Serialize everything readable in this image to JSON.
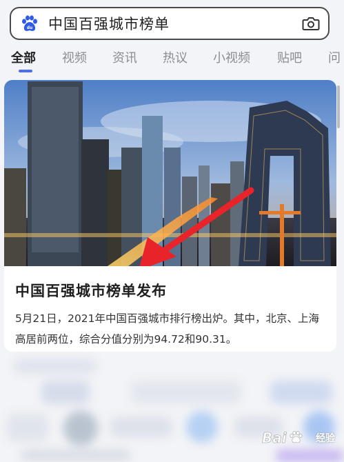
{
  "search": {
    "query": "中国百强城市榜单",
    "logo_icon": "baidu-paw-icon",
    "camera_icon": "camera-icon"
  },
  "tabs": [
    {
      "label": "全部",
      "active": true
    },
    {
      "label": "视频",
      "active": false
    },
    {
      "label": "资讯",
      "active": false
    },
    {
      "label": "热议",
      "active": false
    },
    {
      "label": "小视频",
      "active": false
    },
    {
      "label": "贴吧",
      "active": false
    },
    {
      "label": "问",
      "active": false
    }
  ],
  "result_card": {
    "title": "中国百强城市榜单发布",
    "description": "5月21日，2021年中国百强城市排行榜出炉。其中，北京、上海高居前两位，综合分值分别为94.72和90.31。"
  },
  "watermark": {
    "text": "经验"
  },
  "colors": {
    "accent": "#4e6ef2",
    "annotation_arrow": "#e8232a"
  }
}
